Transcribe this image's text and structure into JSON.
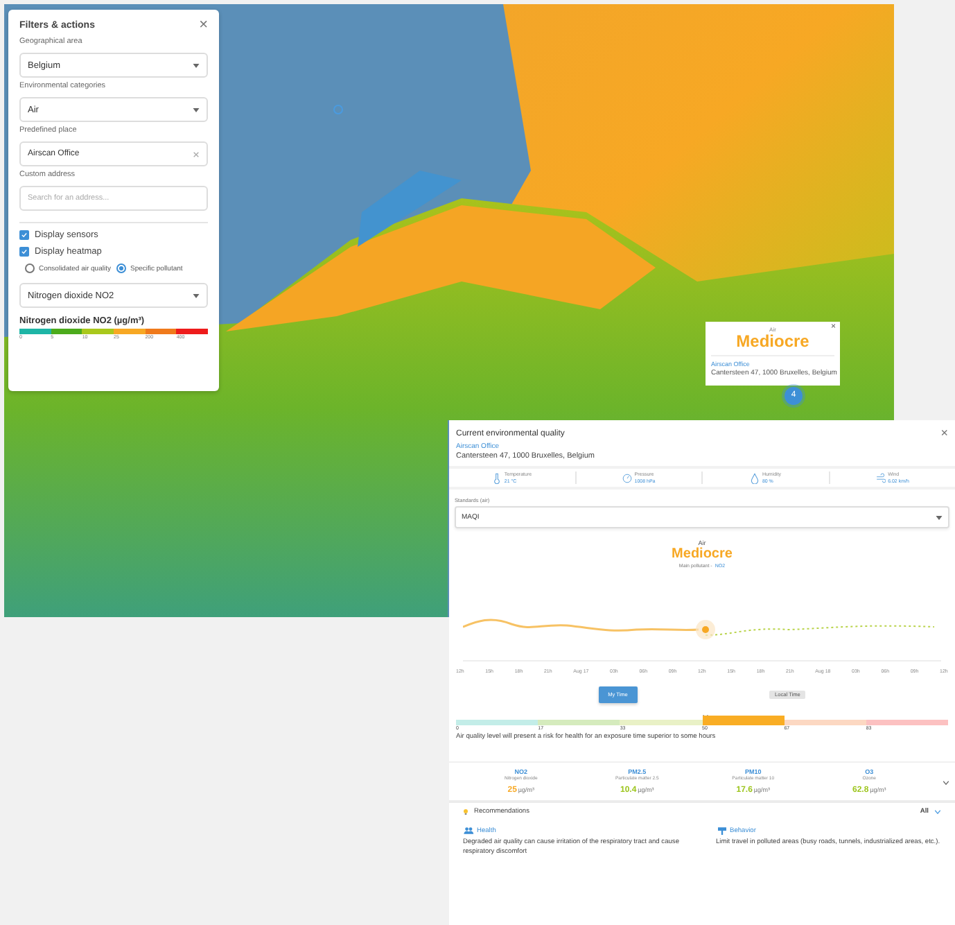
{
  "filters": {
    "title": "Filters & actions",
    "close": "×",
    "fields": [
      {
        "kind": "select",
        "label": "Geographical area",
        "value": "Belgium"
      },
      {
        "kind": "select",
        "label": "Environmental categories",
        "value": "Air"
      },
      {
        "kind": "clearable",
        "label": "Predefined place",
        "value": "Airscan Office"
      },
      {
        "kind": "input",
        "label": "Custom address",
        "placeholder": "Search for an address..."
      }
    ],
    "checkboxes": [
      {
        "label": "Display sensors",
        "checked": true
      },
      {
        "label": "Display heatmap",
        "checked": true
      }
    ],
    "radios": [
      {
        "label": "Consolidated air quality",
        "selected": false
      },
      {
        "label": "Specific pollutant",
        "selected": true
      }
    ],
    "pollutant_select": "Nitrogen dioxide NO2",
    "legend": {
      "title": "Nitrogen dioxide NO2 (µg/m³)",
      "segments": [
        {
          "label": "0",
          "color": "#1eb5a6"
        },
        {
          "label": "5",
          "color": "#4cab1c"
        },
        {
          "label": "10",
          "color": "#a9c81c"
        },
        {
          "label": "25",
          "color": "#f7a824"
        },
        {
          "label": "200",
          "color": "#f07a1c"
        },
        {
          "label": "400",
          "color": "#ee1c1c"
        }
      ]
    }
  },
  "map": {
    "popup": {
      "category": "Air",
      "rating": "Mediocre",
      "place": "Airscan Office",
      "address": "Cantersteen 47, 1000 Bruxelles, Belgium",
      "close": "×"
    },
    "cluster": "4"
  },
  "panel": {
    "title": "Current environmental quality",
    "close": "×",
    "place": "Airscan Office",
    "address": "Cantersteen 47, 1000 Bruxelles, Belgium",
    "weather": [
      {
        "kind": "temperature",
        "label": "Temperature",
        "value": "21 °C"
      },
      {
        "kind": "pressure",
        "label": "Pressure",
        "value": "1008 hPa"
      },
      {
        "kind": "humidity",
        "label": "Humidity",
        "value": "80 %"
      },
      {
        "kind": "wind",
        "label": "Wind",
        "value": "6.02 km/h"
      }
    ],
    "standards_label": "Standards (air)",
    "standards_value": "MAQI",
    "category": "Air",
    "rating": "Mediocre",
    "main_pollutant_label": "Main pollutant -",
    "main_pollutant": "NO2",
    "x_labels": [
      "12h",
      "15h",
      "18h",
      "21h",
      "Aug 17",
      "03h",
      "06h",
      "09h",
      "12h",
      "15h",
      "18h",
      "21h",
      "Aug 18",
      "03h",
      "06h",
      "09h",
      "12h"
    ],
    "time_buttons": [
      {
        "label": "My Time",
        "selected": true
      },
      {
        "label": "Local Time",
        "selected": false
      }
    ],
    "scale": [
      {
        "label": "0",
        "color": "#c3ede8",
        "selected": false
      },
      {
        "label": "17",
        "color": "#d5ebbd",
        "selected": false
      },
      {
        "label": "33",
        "color": "#e9f1c6",
        "selected": false
      },
      {
        "label": "50",
        "color": "#f9ad24",
        "selected": true
      },
      {
        "label": "67",
        "color": "#fcd8c2",
        "selected": false
      },
      {
        "label": "83",
        "color": "#fcc1c1",
        "selected": false
      }
    ],
    "scale_text": "Air quality level will present a risk for health for an exposure time superior to some hours",
    "pollutants": [
      {
        "name": "NO2",
        "description": "Nitrogen dioxide",
        "value": "25",
        "unit": "µg/m³",
        "color": "#f7a824"
      },
      {
        "name": "PM2.5",
        "description": "Particulate matter 2.5",
        "value": "10.4",
        "unit": "µg/m³",
        "color": "#9cc51c"
      },
      {
        "name": "PM10",
        "description": "Particulate matter 10",
        "value": "17.6",
        "unit": "µg/m³",
        "color": "#9cc51c"
      },
      {
        "name": "O3",
        "description": "Ozone",
        "value": "62.8",
        "unit": "µg/m³",
        "color": "#9cc51c"
      }
    ],
    "recommendations_title": "Recommendations",
    "filter_value": "All",
    "recommendations": [
      {
        "kind": "health",
        "title": "Health",
        "text": "Degraded air quality can cause irritation of the respiratory tract and cause respiratory discomfort"
      },
      {
        "kind": "behavior",
        "title": "Behavior",
        "text": "Limit travel in polluted areas (busy roads, tunnels, industrialized areas, etc.)."
      }
    ]
  }
}
